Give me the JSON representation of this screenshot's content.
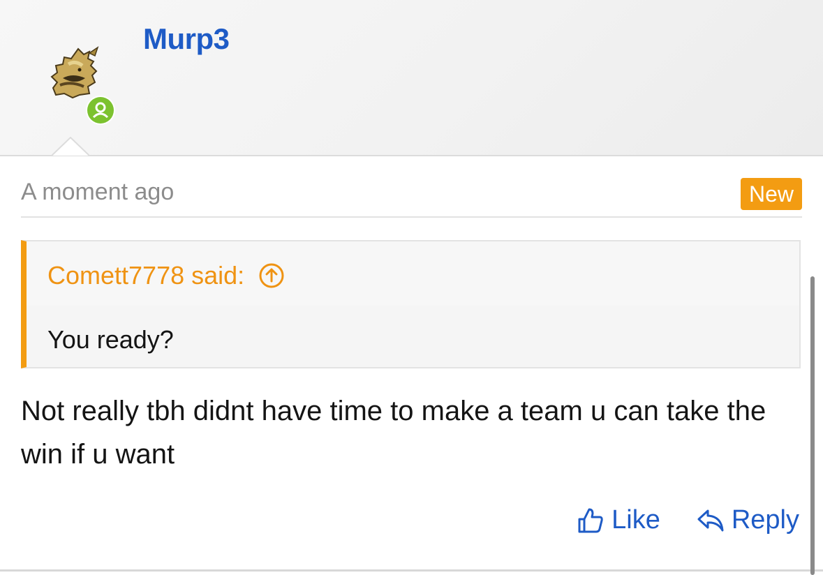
{
  "user": {
    "name": "Murp3",
    "avatar_icon": "pokemon-sprite-avatar",
    "status_icon": "online-user-icon",
    "status_color": "#7cc22f"
  },
  "post": {
    "timestamp": "A moment ago",
    "badge": "New",
    "badge_color": "#f39c12",
    "quote": {
      "author_line": "Comett7778 said:",
      "jump_icon": "arrow-up-circle-icon",
      "text": "You ready?"
    },
    "body": "Not really tbh didnt have time to make a team u can take the win if u want"
  },
  "actions": {
    "like_label": "Like",
    "like_icon": "thumbs-up-icon",
    "reply_label": "Reply",
    "reply_icon": "reply-arrow-icon"
  },
  "colors": {
    "link": "#1e5bc6",
    "accent": "#f39c12"
  }
}
